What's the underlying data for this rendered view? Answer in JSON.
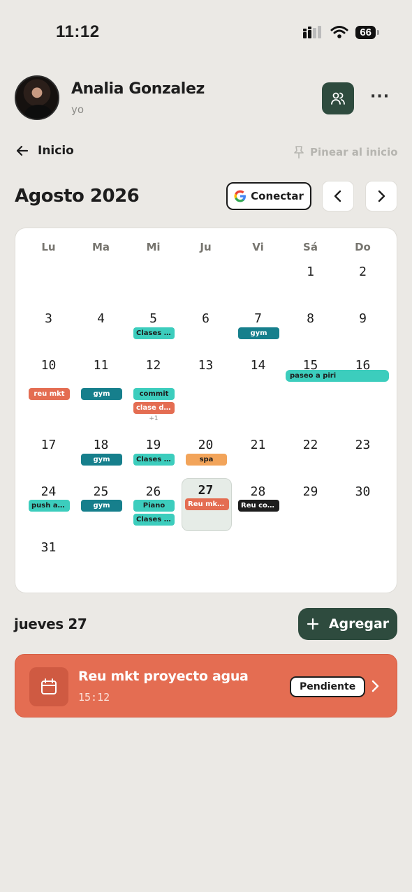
{
  "status_bar": {
    "time": "11:12",
    "battery": "66"
  },
  "profile": {
    "name": "Analia Gonzalez",
    "subtitle": "yo"
  },
  "nav": {
    "back_label": "Inicio",
    "pin_label": "Pinear al inicio"
  },
  "calendar": {
    "month_title": "Agosto 2026",
    "connect_label": "Conectar",
    "weekdays": [
      "Lu",
      "Ma",
      "Mi",
      "Ju",
      "Vi",
      "Sá",
      "Do"
    ],
    "days": [
      "1",
      "2",
      "3",
      "4",
      "5",
      "6",
      "7",
      "8",
      "9",
      "10",
      "11",
      "12",
      "13",
      "14",
      "15",
      "16",
      "17",
      "18",
      "19",
      "20",
      "21",
      "22",
      "23",
      "24",
      "25",
      "26",
      "27",
      "28",
      "29",
      "30",
      "31"
    ],
    "events": [
      {
        "label": "Clases d...",
        "color": "#3ccdbd"
      },
      {
        "label": "gym",
        "color": "#167f8c"
      },
      {
        "label": "paseo a piri",
        "color": "#3ccdbd"
      },
      {
        "label": "reu mkt",
        "color": "#e46d52"
      },
      {
        "label": "gym",
        "color": "#167f8c"
      },
      {
        "label": "commit",
        "color": "#3ccdbd"
      },
      {
        "label": "clase de...",
        "color": "#e46d52"
      },
      {
        "label": "+1",
        "color": "#8a8a86"
      },
      {
        "label": "gym",
        "color": "#167f8c"
      },
      {
        "label": "Clases d...",
        "color": "#3ccdbd"
      },
      {
        "label": "spa",
        "color": "#f2a45a"
      },
      {
        "label": "push a ...",
        "color": "#3ccdbd"
      },
      {
        "label": "gym",
        "color": "#167f8c"
      },
      {
        "label": "Piano",
        "color": "#3ccdbd"
      },
      {
        "label": "Clases d...",
        "color": "#3ccdbd"
      },
      {
        "label": "Reu mkt ...",
        "color": "#e46d52"
      },
      {
        "label": "Reu colab",
        "color": "#1d1d1d"
      }
    ]
  },
  "selected_day": {
    "title": "jueves 27",
    "add_label": "Agregar",
    "event": {
      "title": "Reu mkt proyecto agua",
      "time": "15:12",
      "status": "Pendiente"
    }
  },
  "colors": {
    "accent_green": "#2e4b3e",
    "event_coral": "#e46d52",
    "teal": "#3ccdbd",
    "dark_teal": "#167f8c",
    "orange": "#f2a45a"
  }
}
